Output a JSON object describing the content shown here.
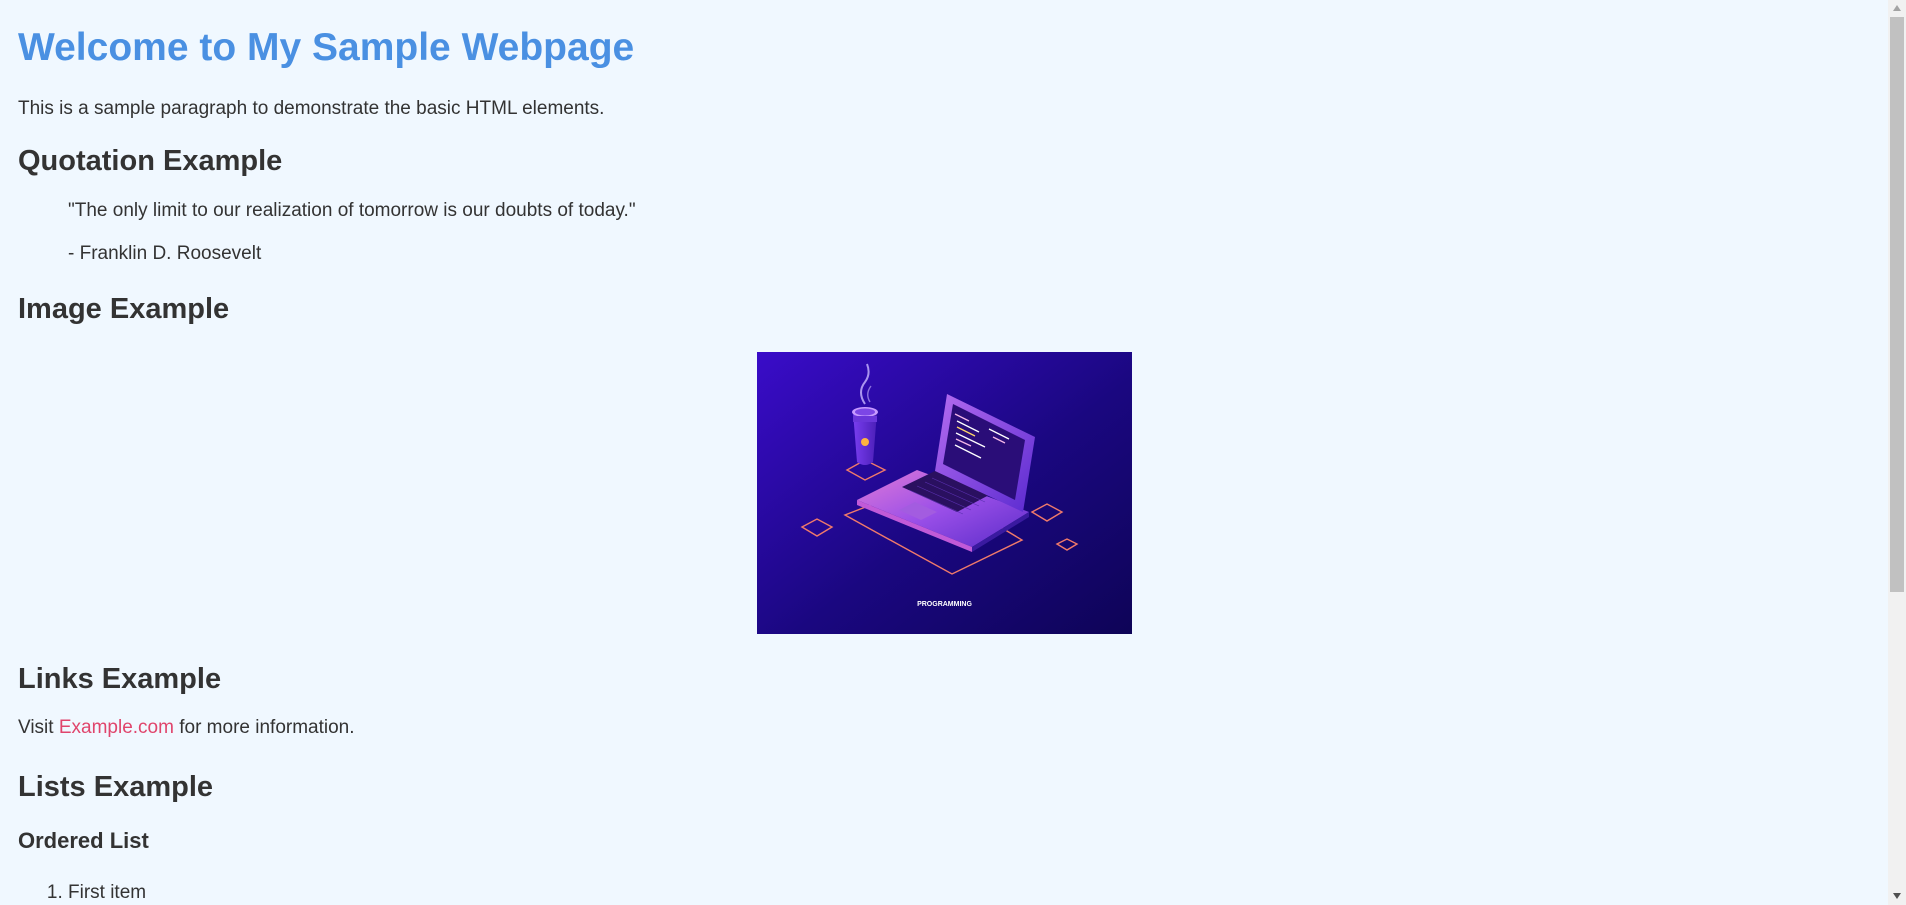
{
  "page": {
    "title": "Welcome to My Sample Webpage",
    "intro": "This is a sample paragraph to demonstrate the basic HTML elements.",
    "accent_color": "#4a90e2",
    "link_color": "#e0456c",
    "background_color": "#f0f8ff"
  },
  "quotation": {
    "heading": "Quotation Example",
    "text": "\"The only limit to our realization of tomorrow is our doubts of today.\"",
    "author": "- Franklin D. Roosevelt"
  },
  "image_section": {
    "heading": "Image Example",
    "image_caption": "PROGRAMMING",
    "image_subject": "isometric laptop with coffee cup illustration"
  },
  "links": {
    "heading": "Links Example",
    "prefix": "Visit",
    "link_text": "Example.com",
    "suffix": "for more information."
  },
  "lists": {
    "heading": "Lists Example",
    "ordered_heading": "Ordered List",
    "ordered_items": [
      "First item"
    ]
  },
  "icons": {
    "scroll_up": "triangle-up-icon",
    "scroll_down": "triangle-down-icon"
  }
}
